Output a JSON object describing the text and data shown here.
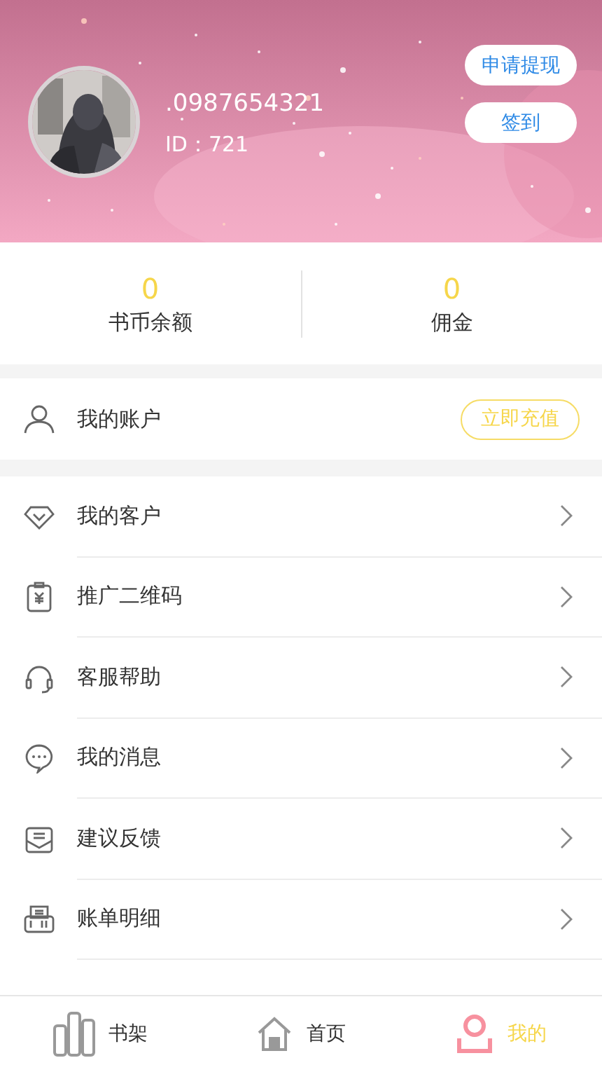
{
  "profile": {
    "phone": ".0987654321",
    "id_text": "ID：721",
    "buttons": [
      {
        "label": "申请提现"
      },
      {
        "label": "签到"
      }
    ]
  },
  "stats": [
    {
      "value": "0",
      "label": "书币余额"
    },
    {
      "value": "0",
      "label": "佣金"
    }
  ],
  "account": {
    "label": "我的账户",
    "action": "立即充值"
  },
  "menu": [
    {
      "kind": "diamond",
      "label": "我的客户"
    },
    {
      "kind": "qr",
      "label": "推广二维码"
    },
    {
      "kind": "headset",
      "label": "客服帮助"
    },
    {
      "kind": "chat",
      "label": "我的消息"
    },
    {
      "kind": "mail",
      "label": "建议反馈"
    },
    {
      "kind": "bill",
      "label": "账单明细"
    }
  ],
  "tabs": [
    {
      "kind": "shelf",
      "label": "书架",
      "selected": false
    },
    {
      "kind": "home",
      "label": "首页",
      "selected": false
    },
    {
      "kind": "user",
      "label": "我的",
      "selected": true
    }
  ]
}
